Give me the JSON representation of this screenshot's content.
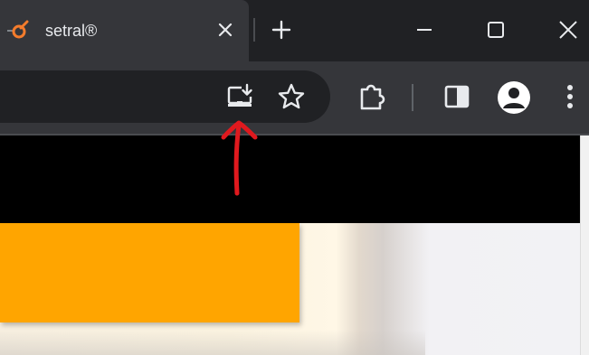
{
  "tab": {
    "title": "setral®",
    "favicon": "setral-logo-icon",
    "close_icon": "close-icon"
  },
  "tabstrip": {
    "new_tab_icon": "plus-icon"
  },
  "window_controls": {
    "minimize_icon": "minimize-icon",
    "maximize_icon": "maximize-icon",
    "close_icon": "close-icon"
  },
  "toolbar": {
    "install_app_icon": "install-app-icon",
    "bookmark_icon": "star-icon",
    "extensions_icon": "puzzle-icon",
    "side_panel_icon": "side-panel-icon",
    "profile_icon": "avatar-icon",
    "menu_icon": "more-vert-icon"
  },
  "page": {
    "card_color": "#ffa500",
    "band_color": "#000000"
  },
  "annotation": {
    "color": "#e0191e",
    "type": "red hand-drawn arrow pointing up"
  }
}
